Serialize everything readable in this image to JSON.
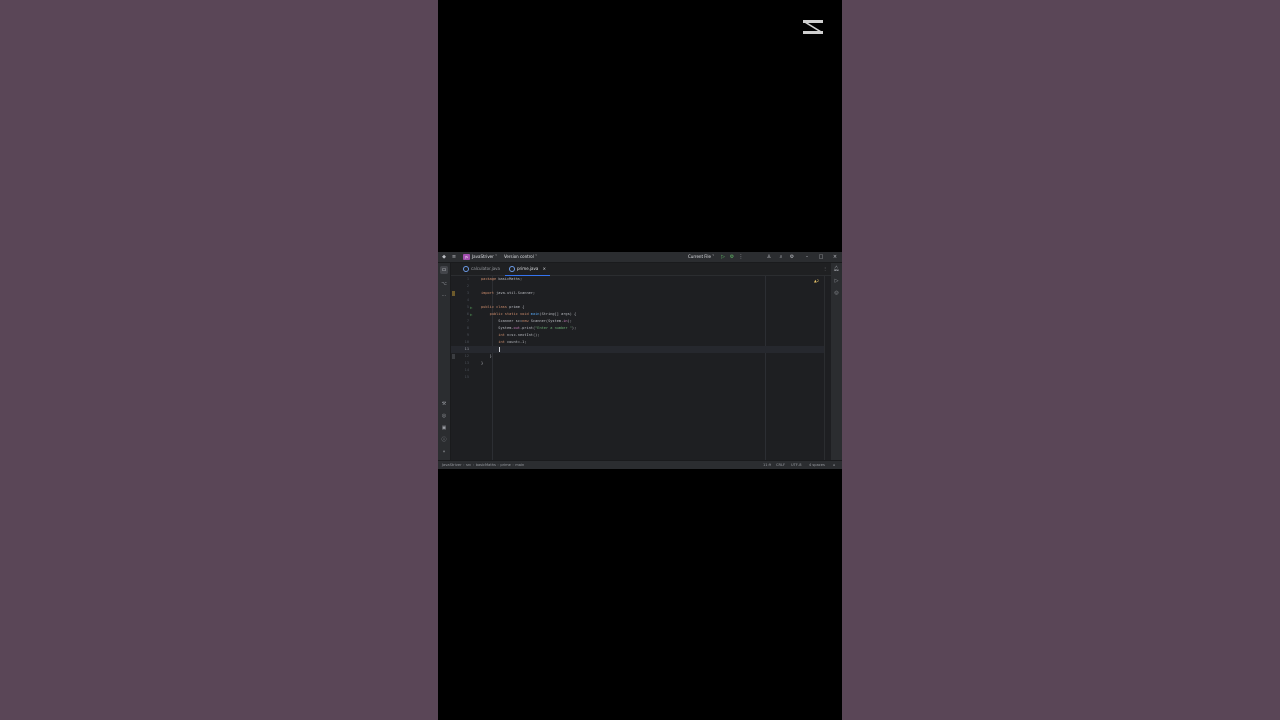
{
  "titlebar": {
    "menu_icon": "hamburger-icon",
    "project_badge": "JS",
    "project_name": "JavaStriver",
    "vcs": "Version control",
    "run_config": "Current File"
  },
  "tabs": [
    {
      "label": "calculator.java",
      "active": false
    },
    {
      "label": "prime.java",
      "active": true
    }
  ],
  "editor": {
    "inspection": "▲2",
    "lines": [
      {
        "n": "1",
        "text": "package basicMaths;"
      },
      {
        "n": "2",
        "text": ""
      },
      {
        "n": "3",
        "text": "import java.util.Scanner;"
      },
      {
        "n": "4",
        "text": ""
      },
      {
        "n": "5",
        "text": "public class prime {"
      },
      {
        "n": "6",
        "text": "    public static void main(String[] args) {"
      },
      {
        "n": "7",
        "text": "        Scanner sc=new Scanner(System.in);"
      },
      {
        "n": "8",
        "text": "        System.out.print(\"Enter a number \");"
      },
      {
        "n": "9",
        "text": "        int n=sc.nextInt();"
      },
      {
        "n": "10",
        "text": "        int count=-1;"
      },
      {
        "n": "11",
        "text": ""
      },
      {
        "n": "12",
        "text": "    }"
      },
      {
        "n": "13",
        "text": "}"
      },
      {
        "n": "14",
        "text": ""
      },
      {
        "n": "15",
        "text": ""
      }
    ]
  },
  "statusbar": {
    "crumbs": [
      "JavaStriver",
      "src",
      "basicMaths",
      "prime",
      "main"
    ],
    "position": "11:9",
    "line_sep": "CRLF",
    "encoding": "UTF-8",
    "indent": "4 spaces"
  }
}
